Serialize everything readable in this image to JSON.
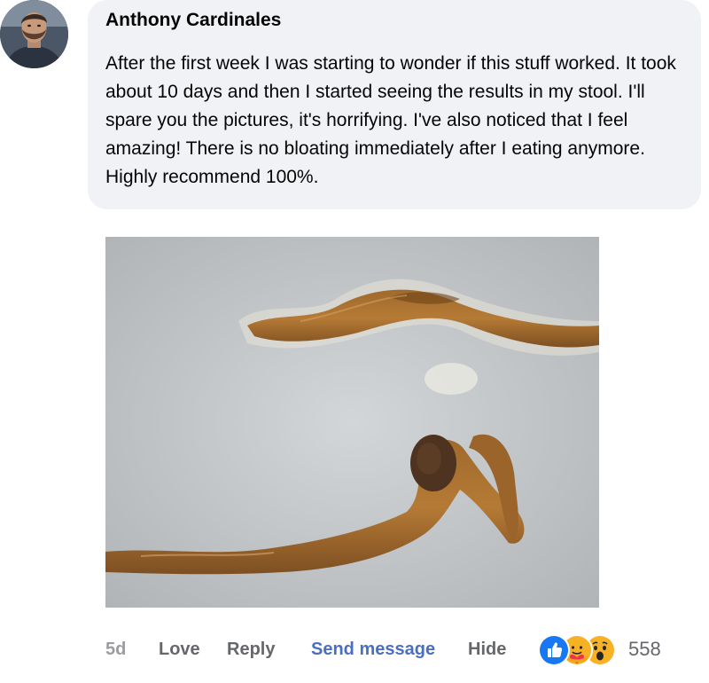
{
  "comment": {
    "author": "Anthony Cardinales",
    "text": "After the first week I was starting to wonder if this stuff worked. It took about 10 days and then I started seeing the results in my stool. I'll spare you the pictures, it's horrifying. I've also noticed that I feel amazing! There is no bloating immediately after I eating anymore. Highly recommend 100%."
  },
  "attachment": {
    "icon": "photo"
  },
  "actions": {
    "timestamp": "5d",
    "love": "Love",
    "reply": "Reply",
    "send_message": "Send message",
    "hide": "Hide"
  },
  "reactions": {
    "types": [
      "like",
      "care",
      "wow"
    ],
    "count": "558"
  },
  "colors": {
    "bubble": "#f0f2f5",
    "link_accent": "#4b6fc0",
    "muted": "#65676b",
    "like_blue": "#1877f2"
  }
}
